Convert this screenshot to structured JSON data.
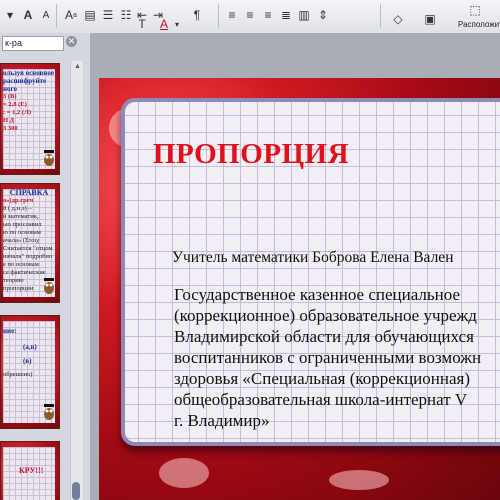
{
  "toolbar": {
    "font_size_grow": "A",
    "font_size_shrink": "A",
    "paragraph_mark": "¶",
    "arrange_label": "Расположить",
    "font_color": "#e01c26"
  },
  "sidebar": {
    "search_value": "к-ра",
    "thumbnails": [
      {
        "lines": [
          "ользуя основное",
          "расшифруйте",
          "ного",
          "3   (В)",
          "= 2,8   (Е)",
          ": = 1,2   (Л)",
          "Н   Д",
          "3   300"
        ]
      },
      {
        "heading": "СПРАВКА",
        "lines": [
          "о»(др.греч",
          "8 ( д.н.э) –",
          "й математик,",
          "ью прославил",
          "ю по основам",
          "ачала» (Στοιχ",
          "Считается \"отцом",
          "начала\" подробно",
          "е по основам",
          "се фактические",
          "теорию пропорции"
        ]
      },
      {
        "lines": [
          "ние:",
          "(а,в)",
          "(в)",
          "обрешено)"
        ]
      },
      {
        "lines": [
          "КРУ!!!"
        ]
      }
    ]
  },
  "slide": {
    "title": "ПРОПОРЦИЯ",
    "teacher": "Учитель математики Боброва Елена Вален",
    "organization_lines": [
      "Государственное казенное специальное",
      "(коррекционное) образовательное учрежд",
      "Владимирской области для обучающихся",
      "воспитанников с ограниченными возможн",
      "здоровья «Специальная (коррекционная)",
      "общеобразовательная  школа-интернат V",
      " г. Владимир»"
    ],
    "title_color": "#e0101c"
  }
}
